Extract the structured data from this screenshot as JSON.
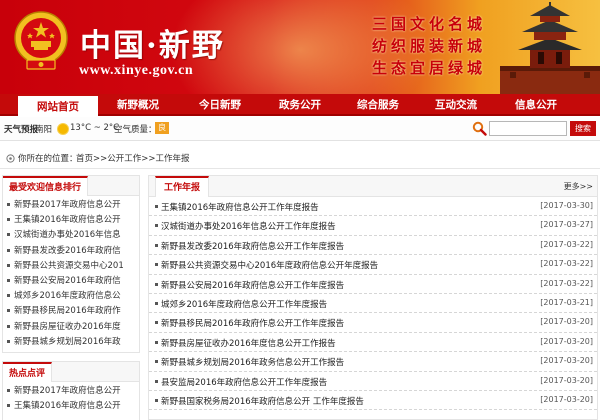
{
  "header": {
    "site_name": "中国·新野",
    "url": "www.xinye.gov.cn",
    "slogans": [
      "三国文化名城",
      "纺织服装新城",
      "生态宜居绿城"
    ]
  },
  "nav": {
    "items": [
      "网站首页",
      "新野概况",
      "今日新野",
      "政务公开",
      "综合服务",
      "互动交流",
      "信息公开"
    ],
    "active_index": 0
  },
  "infobar": {
    "weather_label": "天气预报",
    "city": "南阳",
    "temperature": "13°C ~ 2°C",
    "air_quality_label": "空气质量：",
    "air_quality_value": "良",
    "search_placeholder": "",
    "search_button": "搜索"
  },
  "breadcrumb": {
    "prefix": "你所在的位置：",
    "path": "首页>>公开工作>>工作年报"
  },
  "sidebar": {
    "popular": {
      "title": "最受欢迎信息排行",
      "items": [
        "新野县2017年政府信息公开",
        "王集镇2016年政府信息公开",
        "汉城街道办事处2016年信息",
        "新野县发改委2016年政府信",
        "新野县公共资源交易中心201",
        "新野县公安局2016年政府信",
        "城郊乡2016年度政府信息公",
        "新野县移民局2016年政府作",
        "新野县房屋征收办2016年度",
        "新野县城乡规划局2016年政"
      ]
    },
    "hot": {
      "title": "热点点评",
      "items": [
        "新野县2017年政府信息公开",
        "王集镇2016年政府信息公开"
      ]
    }
  },
  "main": {
    "title": "工作年报",
    "more_label": "更多>>",
    "rows": [
      {
        "title": "王集镇2016年政府信息公开工作年度报告",
        "date": "[2017-03-30]"
      },
      {
        "title": "汉城街道办事处2016年信息公开工作年度报告",
        "date": "[2017-03-27]"
      },
      {
        "title": "新野县发改委2016年政府信息公开工作年度报告",
        "date": "[2017-03-22]"
      },
      {
        "title": "新野县公共资源交易中心2016年度政府信息公开年度报告",
        "date": "[2017-03-22]"
      },
      {
        "title": "新野县公安局2016年政府信息公开工作年度报告",
        "date": "[2017-03-22]"
      },
      {
        "title": "城郊乡2016年度政府信息公开工作年度报告",
        "date": "[2017-03-21]"
      },
      {
        "title": "新野县移民局2016年政府作息公开工作年度报告",
        "date": "[2017-03-20]"
      },
      {
        "title": "新野县房屋征收办2016年度信息公开工作报告",
        "date": "[2017-03-20]"
      },
      {
        "title": "新野县城乡规划局2016年政务信息公开工作报告",
        "date": "[2017-03-20]"
      },
      {
        "title": "县安监局2016年政府信息公开工作年度报告",
        "date": "[2017-03-20]"
      },
      {
        "title": "新野县国家税务局2016年政府信息公开 工作年度报告",
        "date": "[2017-03-20]"
      }
    ]
  },
  "colors": {
    "brand_red": "#c40a0a",
    "banner_gold": "#f6c040",
    "air_quality_badge": "#f0a020"
  },
  "icons": [
    "national-emblem-icon",
    "tower-icon",
    "sun-icon",
    "search-icon",
    "location-pin-icon"
  ]
}
